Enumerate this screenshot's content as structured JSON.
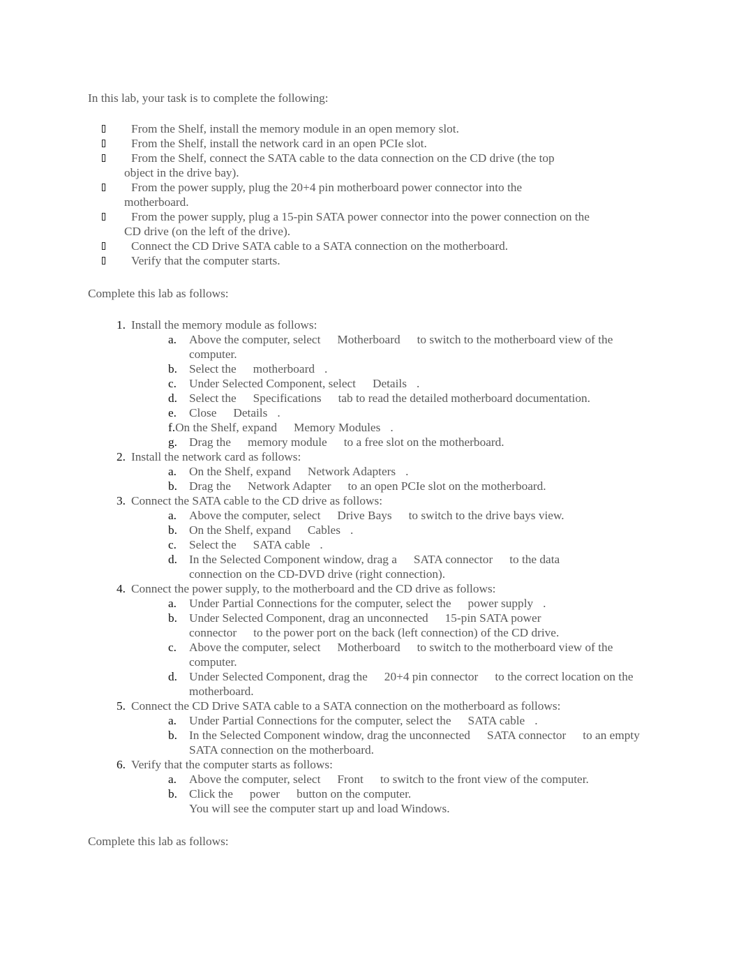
{
  "intro": "In this lab, your task is to complete the following:",
  "tasks": [
    "From the Shelf, install the memory module in an open memory slot.",
    "From the Shelf, install the network card in an open PCIe slot.",
    "From the Shelf, connect the SATA cable to the data connection on the CD drive (the top object in the drive bay).",
    "From the power supply, plug the 20+4 pin motherboard power connector into the motherboard.",
    "From the power supply, plug a 15-pin SATA power connector into the power connection on the CD drive (on the left of the drive).",
    "Connect the CD Drive SATA cable to a SATA connection on the motherboard.",
    "Verify that the computer starts."
  ],
  "bullet_icon": "missing-glyph-box",
  "section_heading": "Complete this lab as follows:",
  "steps": [
    {
      "marker": "1.",
      "title": "Install the memory module as follows:",
      "substeps": [
        {
          "marker": "a.",
          "pre": "Above the computer, select",
          "ui": "Motherboard",
          "post": "to switch to the motherboard view of the computer."
        },
        {
          "marker": "b.",
          "pre": "Select the",
          "ui": "motherboard",
          "post": "."
        },
        {
          "marker": "c.",
          "pre": "Under Selected Component, select",
          "ui": "Details",
          "post": "."
        },
        {
          "marker": "d.",
          "pre": "Select the",
          "ui": "Specifications",
          "post": "tab to read the detailed motherboard documentation."
        },
        {
          "marker": "e.",
          "pre": "Close",
          "ui": "Details",
          "post": "."
        },
        {
          "marker": "f.",
          "pre": "On the Shelf, expand",
          "ui": "Memory Modules",
          "post": "."
        },
        {
          "marker": "g.",
          "pre": "Drag the",
          "ui": "memory module",
          "post": "to a free slot on the motherboard."
        }
      ]
    },
    {
      "marker": "2.",
      "title": "Install the network card as follows:",
      "substeps": [
        {
          "marker": "a.",
          "pre": "On the Shelf, expand",
          "ui": "Network Adapters",
          "post": "."
        },
        {
          "marker": "b.",
          "pre": "Drag the",
          "ui": "Network Adapter",
          "post": "to an open PCIe slot on the motherboard."
        }
      ]
    },
    {
      "marker": "3.",
      "title": "Connect the SATA cable to the CD drive as follows:",
      "substeps": [
        {
          "marker": "a.",
          "pre": "Above the computer, select",
          "ui": "Drive Bays",
          "post": "to switch to the drive bays view."
        },
        {
          "marker": "b.",
          "pre": "On the Shelf, expand",
          "ui": "Cables",
          "post": "."
        },
        {
          "marker": "c.",
          "pre": "Select the",
          "ui": "SATA cable",
          "post": "."
        },
        {
          "marker": "d.",
          "pre": "In the Selected Component window, drag a",
          "ui": "SATA connector",
          "post": "to the data connection on the CD-DVD drive (right connection)."
        }
      ]
    },
    {
      "marker": "4.",
      "title": "Connect the power supply, to the motherboard and the CD drive as follows:",
      "substeps": [
        {
          "marker": "a.",
          "pre": "Under Partial Connections for the computer, select the",
          "ui": "power supply",
          "post": "."
        },
        {
          "marker": "b.",
          "pre": "Under Selected Component, drag an unconnected",
          "ui": "15-pin SATA power connector",
          "post": "to the power port on the back (left connection) of the CD drive."
        },
        {
          "marker": "c.",
          "pre": "Above the computer, select",
          "ui": "Motherboard",
          "post": "to switch to the motherboard view of the computer."
        },
        {
          "marker": "d.",
          "pre": "Under Selected Component, drag the",
          "ui": "20+4 pin connector",
          "post": "to the correct location on the motherboard."
        }
      ]
    },
    {
      "marker": "5.",
      "title": "Connect the CD Drive SATA cable to a SATA connection on the motherboard as follows:",
      "substeps": [
        {
          "marker": "a.",
          "pre": "Under Partial Connections for the computer, select the",
          "ui": "SATA cable",
          "post": "."
        },
        {
          "marker": "b.",
          "pre": "In the Selected Component window, drag the unconnected",
          "ui": "SATA connector",
          "post": "to an empty SATA connection on the motherboard."
        }
      ]
    },
    {
      "marker": "6.",
      "title": "Verify that the computer starts as follows:",
      "substeps": [
        {
          "marker": "a.",
          "pre": "Above the computer, select",
          "ui": "Front",
          "post": "to switch to the front view of the computer."
        },
        {
          "marker": "b.",
          "pre": "Click the",
          "ui": "power",
          "post": "button on the computer.",
          "note": "You will see the computer start up and load Windows."
        }
      ]
    }
  ],
  "closing_heading": "Complete this lab as follows:"
}
